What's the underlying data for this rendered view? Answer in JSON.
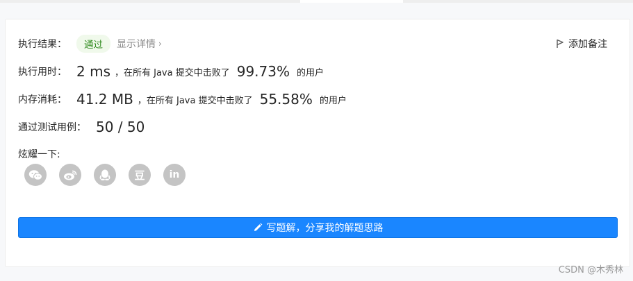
{
  "result": {
    "label": "执行结果：",
    "status": "通过",
    "details_link": "显示详情",
    "add_note": "添加备注"
  },
  "runtime": {
    "label": "执行用时：",
    "value": "2 ms",
    "beat_text": "，在所有 Java 提交中击败了",
    "percent": "99.73%",
    "suffix": "的用户"
  },
  "memory": {
    "label": "内存消耗：",
    "value": "41.2 MB",
    "beat_text": "，在所有 Java 提交中击败了",
    "percent": "55.58%",
    "suffix": "的用户"
  },
  "tests": {
    "label": "通过测试用例：",
    "value": "50 / 50"
  },
  "share": {
    "label": "炫耀一下:",
    "icons": [
      "wechat-icon",
      "weibo-icon",
      "qq-icon",
      "douban-icon",
      "linkedin-icon"
    ],
    "douban_glyph": "豆",
    "linkedin_glyph": "in"
  },
  "write_solution": {
    "label": "写题解，分享我的解题思路"
  },
  "watermark": "CSDN @木秀林",
  "colors": {
    "accent": "#1a86ff",
    "success_bg": "#f0f9eb",
    "success_text": "#2f8a1e",
    "icon_grey": "#c4c4c4"
  }
}
